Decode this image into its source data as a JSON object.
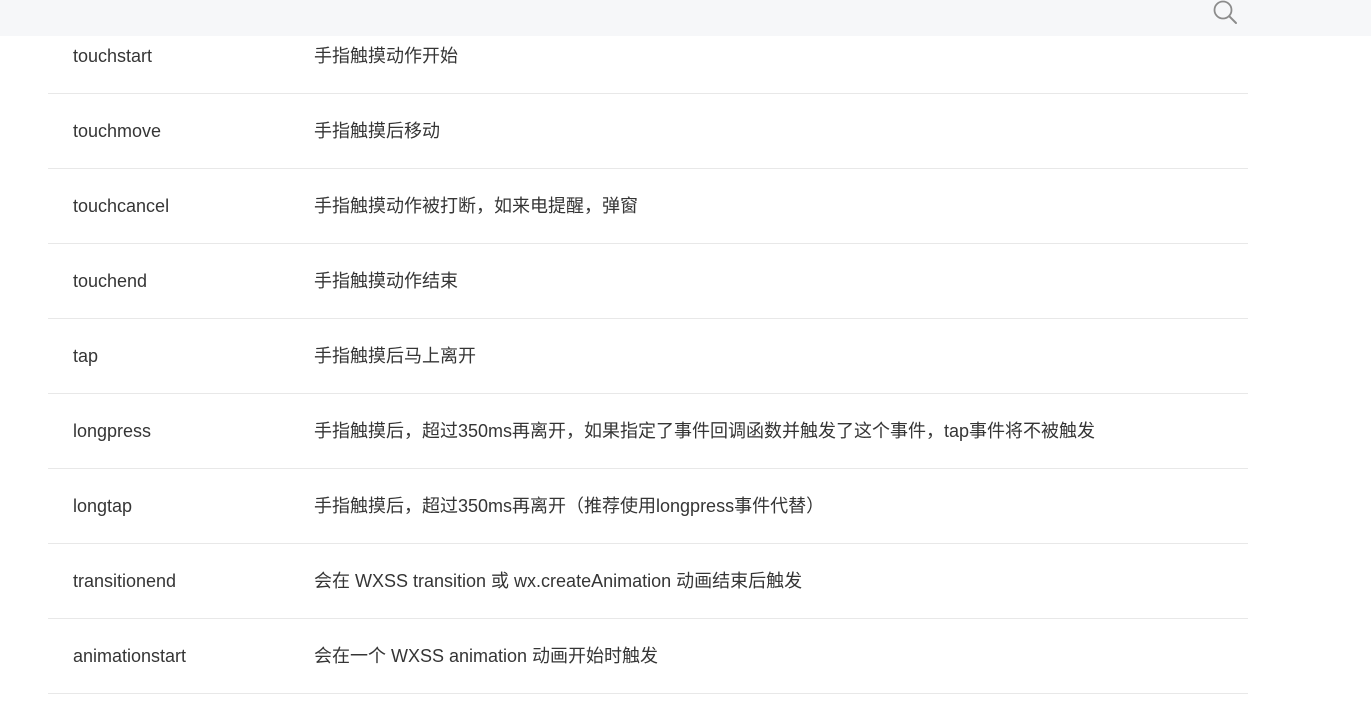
{
  "header": {
    "search_icon": "search-icon"
  },
  "events_table": {
    "rows": [
      {
        "name": "touchstart",
        "description": "手指触摸动作开始"
      },
      {
        "name": "touchmove",
        "description": "手指触摸后移动"
      },
      {
        "name": "touchcancel",
        "description": "手指触摸动作被打断，如来电提醒，弹窗"
      },
      {
        "name": "touchend",
        "description": "手指触摸动作结束"
      },
      {
        "name": "tap",
        "description": "手指触摸后马上离开"
      },
      {
        "name": "longpress",
        "description": "手指触摸后，超过350ms再离开，如果指定了事件回调函数并触发了这个事件，tap事件将不被触发"
      },
      {
        "name": "longtap",
        "description": "手指触摸后，超过350ms再离开（推荐使用longpress事件代替）"
      },
      {
        "name": "transitionend",
        "description": "会在 WXSS transition 或 wx.createAnimation 动画结束后触发"
      },
      {
        "name": "animationstart",
        "description": "会在一个 WXSS animation 动画开始时触发"
      }
    ]
  }
}
